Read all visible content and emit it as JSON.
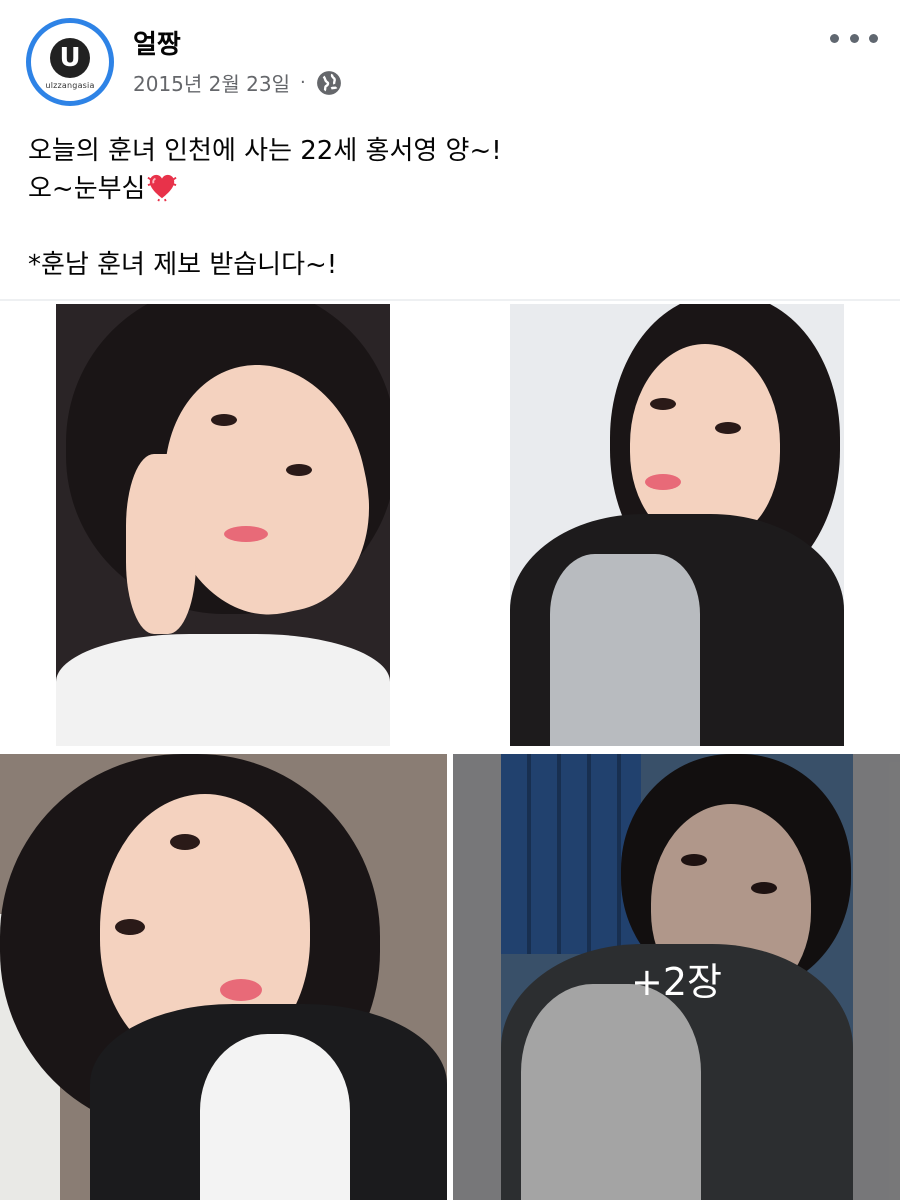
{
  "page": {
    "name": "얼짱",
    "avatar_logo_letter": "U",
    "avatar_logo_text": "ulzzangasia"
  },
  "meta": {
    "date": "2015년 2월 23일",
    "separator": "·",
    "privacy_icon": "globe-icon"
  },
  "post": {
    "lines": [
      "오늘의 훈녀 인천에 사는 22세 홍서영 양~!",
      "오~눈부심",
      "",
      "*훈남 훈녀 제보 받습니다~!"
    ],
    "emoji_icon": "sparkling-heart-icon"
  },
  "photos": {
    "count": 4,
    "more_label": "+2장"
  },
  "colors": {
    "avatar_ring": "#2e83e6",
    "meta_text": "#65676b",
    "heart": "#e8324a"
  }
}
